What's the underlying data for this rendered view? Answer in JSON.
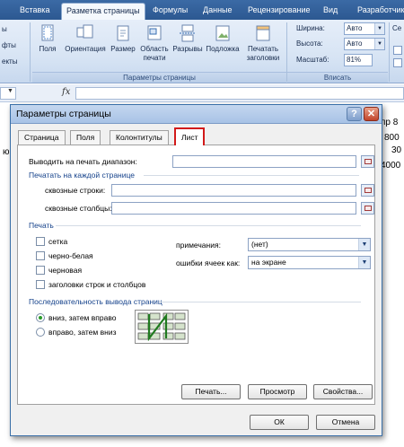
{
  "ribbon": {
    "tabs": [
      "Вставка",
      "Разметка страницы",
      "Формулы",
      "Данные",
      "Рецензирование",
      "Вид",
      "Разработчик"
    ],
    "left_items": [
      "ы",
      "фты",
      "екты"
    ],
    "buttons": [
      {
        "label": "Поля"
      },
      {
        "label": "Ориентация"
      },
      {
        "label": "Размер"
      },
      {
        "label": "Область печати"
      },
      {
        "label": "Разрывы"
      },
      {
        "label": "Подложка"
      },
      {
        "label": "Печатать заголовки"
      }
    ],
    "group_page_setup": "Параметры страницы",
    "group_fit": "Вписать",
    "group_right": "Се",
    "scale": {
      "width_label": "Ширина:",
      "width_value": "Авто",
      "height_label": "Высота:",
      "height_value": "Авто",
      "scale_label": "Масштаб:",
      "scale_value": "81%"
    }
  },
  "formula_bar": {
    "fx": "fx"
  },
  "sheet": {
    "header_fragment": "пр 8",
    "values": [
      "800",
      "30",
      "4000"
    ],
    "left_fragment": "ю"
  },
  "dialog": {
    "title": "Параметры страницы",
    "help": "?",
    "close": "✕",
    "tabs": [
      "Страница",
      "Поля",
      "Колонтитулы",
      "Лист"
    ],
    "active_tab": "Лист",
    "print_area_label": "Выводить на печать диапазон:",
    "print_titles_section": "Печатать на каждой странице",
    "rows_label": "сквозные строки:",
    "cols_label": "сквозные столбцы:",
    "print_section": "Печать",
    "checkboxes": [
      "сетка",
      "черно-белая",
      "черновая",
      "заголовки строк и столбцов"
    ],
    "comments_label": "примечания:",
    "comments_value": "(нет)",
    "errors_label": "ошибки ячеек как:",
    "errors_value": "на экране",
    "order_section": "Последовательность вывода страниц",
    "order_options": [
      "вниз, затем вправо",
      "вправо, затем вниз"
    ],
    "order_selected": "вниз, затем вправо",
    "btn_print": "Печать...",
    "btn_preview": "Просмотр",
    "btn_props": "Свойства...",
    "btn_ok": "ОК",
    "btn_cancel": "Отмена"
  }
}
